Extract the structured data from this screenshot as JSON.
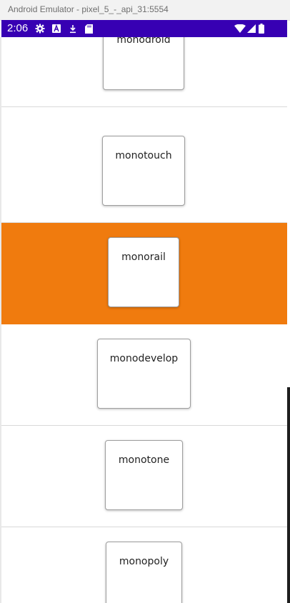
{
  "window": {
    "title": "Android Emulator - pixel_5_-_api_31:5554"
  },
  "status_bar": {
    "time": "2:06",
    "background": "#3700b3",
    "left_icons": [
      "settings-gear-icon",
      "a-letter-icon",
      "download-icon",
      "sd-card-icon"
    ],
    "right_icons": [
      "wifi-icon",
      "cell-signal-icon",
      "battery-icon"
    ]
  },
  "list": {
    "selected_color": "#f07b0e",
    "items": [
      {
        "label": "monodroid",
        "selected": false
      },
      {
        "label": "monotouch",
        "selected": false
      },
      {
        "label": "monorail",
        "selected": true
      },
      {
        "label": "monodevelop",
        "selected": false
      },
      {
        "label": "monotone",
        "selected": false
      },
      {
        "label": "monopoly",
        "selected": false
      }
    ]
  }
}
